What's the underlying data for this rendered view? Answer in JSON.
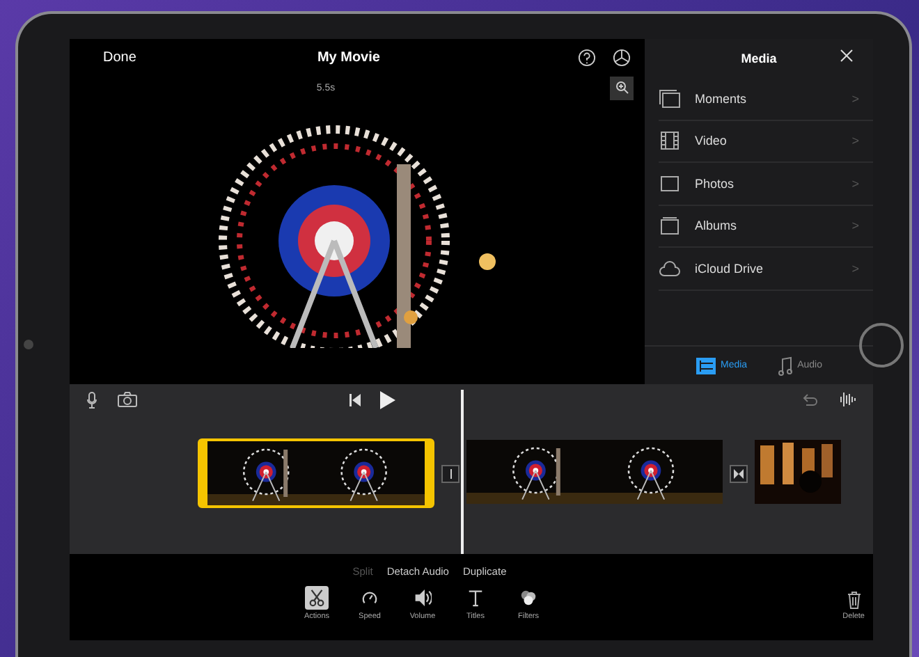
{
  "header": {
    "done": "Done",
    "title": "My Movie",
    "duration": "5.5s"
  },
  "media_panel": {
    "title": "Media",
    "items": [
      {
        "label": "Moments",
        "kind": "moments",
        "chevron": ">"
      },
      {
        "label": "Video",
        "kind": "video",
        "chevron": ">"
      },
      {
        "label": "Photos",
        "kind": "photos",
        "chevron": ">"
      },
      {
        "label": "Albums",
        "kind": "albums",
        "chevron": ">"
      },
      {
        "label": "iCloud Drive",
        "kind": "cloud",
        "chevron": ">"
      }
    ],
    "tabs": [
      {
        "label": "Media",
        "kind": "media",
        "selected": true
      },
      {
        "label": "Audio",
        "kind": "audio",
        "selected": false
      }
    ]
  },
  "timeline": {
    "clips": [
      {
        "kind": "picture",
        "selected": true
      },
      {
        "kind": "picture",
        "selected": false
      },
      {
        "kind": "picture",
        "selected": false
      }
    ]
  },
  "clip_actions": [
    {
      "label": "Split",
      "disabled": true
    },
    {
      "label": "Detach Audio",
      "disabled": false
    },
    {
      "label": "Duplicate",
      "disabled": false
    }
  ],
  "tools": [
    {
      "label": "Actions",
      "kind": "scissors",
      "selected": true
    },
    {
      "label": "Speed",
      "kind": "speed",
      "selected": false
    },
    {
      "label": "Volume",
      "kind": "volume",
      "selected": false
    },
    {
      "label": "Titles",
      "kind": "titles",
      "selected": false
    },
    {
      "label": "Filters",
      "kind": "filters",
      "selected": false
    }
  ],
  "delete": "Delete"
}
